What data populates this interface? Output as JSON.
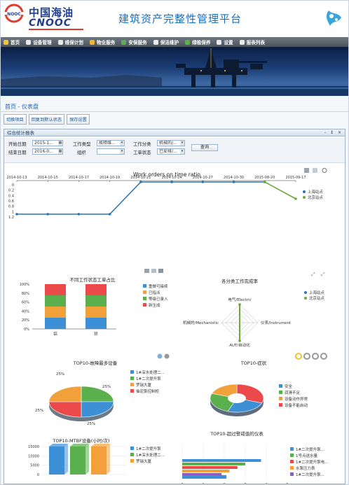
{
  "header": {
    "brand_cn": "中国海油",
    "brand_en": "CNOOC",
    "platform_title": "建筑资产完整性管理平台"
  },
  "menu": [
    {
      "label": "首页",
      "color": "#f2c232"
    },
    {
      "label": "设备管理",
      "color": "#e9e9e9"
    },
    {
      "label": "维保计划",
      "color": "#e9e9e9"
    },
    {
      "label": "物业服务",
      "color": "#f0b23a"
    },
    {
      "label": "安保服务",
      "color": "#5ab04c"
    },
    {
      "label": "保洁维护",
      "color": "#e9e9e9"
    },
    {
      "label": "绿植保养",
      "color": "#5ab04c"
    },
    {
      "label": "设置",
      "color": "#e9e9e9"
    },
    {
      "label": "报表列表",
      "color": "#e9e9e9"
    }
  ],
  "breadcrumb": "首页 - 仪表盘",
  "toolbar": {
    "switch_label": "切换项目",
    "reset_label": "回复到默认状态",
    "save_label": "保存设置"
  },
  "panel": {
    "title": "综合统计报表",
    "tools": "- ↕ ×"
  },
  "filters": {
    "start_label": "开始日期",
    "start_value": "2015-1...",
    "end_label": "结束日期",
    "end_value": "2016-0...",
    "worktype_label": "工作类型",
    "worktype_value": "故障维...",
    "org_label": "组织",
    "org_value": "",
    "category_label": "工作分类",
    "category_value": "机械的/...",
    "status_label": "工单状态",
    "status_value": "已安排/...",
    "query_label": "查询"
  },
  "chart_data": [
    {
      "type": "line",
      "title": "Work orders on time ratio",
      "x": [
        "2014-10-13",
        "2014-10-15",
        "2014-10-17",
        "2014-10-19",
        "2014-10-21",
        "2014-10-24",
        "2014-10-27",
        "2014-10-30",
        "2015-08-20",
        "2015-09-17"
      ],
      "x_ticks": [
        "0",
        "0.2",
        "0.4",
        "0.6",
        "0.8",
        "1",
        "1.2"
      ],
      "series": [
        {
          "name": "上海站点",
          "color": "#2a74b8",
          "values": [
            1,
            1,
            1,
            1,
            0,
            0,
            0,
            0,
            0,
            null
          ]
        },
        {
          "name": "北京站点",
          "color": "#6aaa3a",
          "values": [
            null,
            null,
            null,
            null,
            null,
            null,
            null,
            null,
            0,
            0.5
          ]
        }
      ]
    },
    {
      "type": "bar",
      "title": "不同工作状态工单占比",
      "categories": [
        "铝",
        "轿"
      ],
      "ylim": [
        0,
        100
      ],
      "y_ticks": [
        "0%",
        "20%",
        "40%",
        "60%",
        "80%",
        "100%"
      ],
      "series": [
        {
          "name": "重做可接续",
          "color": "#3d8fd6",
          "values": [
            25,
            25
          ]
        },
        {
          "name": "已指派",
          "color": "#f2a13a",
          "values": [
            25,
            25
          ]
        },
        {
          "name": "等级已录入",
          "color": "#5ab04c",
          "values": [
            25,
            25
          ]
        },
        {
          "name": "新生成",
          "color": "#ec4a4a",
          "values": [
            25,
            25
          ]
        }
      ]
    },
    {
      "type": "radar",
      "title": "各分类工作完成率",
      "axes": [
        "电气/Electric",
        "仪表/Instrument",
        "AUT/自动化",
        "机械的/Mechanistic"
      ],
      "series": [
        {
          "name": "上海站点",
          "color": "#2a74b8"
        },
        {
          "name": "北京站点",
          "color": "#6aaa3a"
        }
      ]
    },
    {
      "type": "pie",
      "title": "TOP10-故障最多设备",
      "labels": [
        "1#深水处理二...",
        "1#二次提升泵",
        "罗瑞大厦",
        "抽泥泵控制柜"
      ],
      "values": [
        25,
        25,
        25,
        25
      ],
      "value_labels": [
        "25%",
        "25%",
        "25%",
        "25%"
      ],
      "colors": [
        "#3d8fd6",
        "#5ab04c",
        "#f2a13a",
        "#ec4a4a"
      ]
    },
    {
      "type": "pie",
      "title": "TOP10-症状",
      "labels": [
        "安全",
        "润滑不足",
        "设备动作异常",
        "设备不能启动"
      ],
      "colors": [
        "#3d8fd6",
        "#5ab04c",
        "#f2a13a",
        "#ec4a4a"
      ]
    },
    {
      "type": "bar",
      "title": "TOP10-MTBF设备(小时/次)",
      "categories": [
        "1#二次提升泵",
        "1#深水处理二...",
        "罗瑞大厦"
      ],
      "values": [
        15000,
        15000,
        15000
      ],
      "ylim": [
        0,
        15000
      ],
      "y_ticks": [
        "0",
        "5000",
        "10000",
        "15000"
      ],
      "colors": [
        "#3d8fd6",
        "#5ab04c",
        "#f2a13a"
      ]
    },
    {
      "type": "bar",
      "orientation": "horizontal",
      "title": "TOP10-超过警戒值的仪表",
      "categories": [
        "1#二次提升泵...",
        "1号点送水量",
        "1#二次提升泵电...",
        "水泵压力表",
        "1#二次提升泵..."
      ],
      "values": [
        5,
        4,
        3.5,
        3,
        2.5
      ],
      "xlim": [
        0,
        5
      ],
      "x_ticks": [
        "0",
        "1",
        "2",
        "3",
        "4",
        "5"
      ],
      "colors": [
        "#3d8fd6",
        "#5ab04c",
        "#ec4a4a",
        "#f2a13a",
        "#8e5cc0"
      ]
    }
  ]
}
